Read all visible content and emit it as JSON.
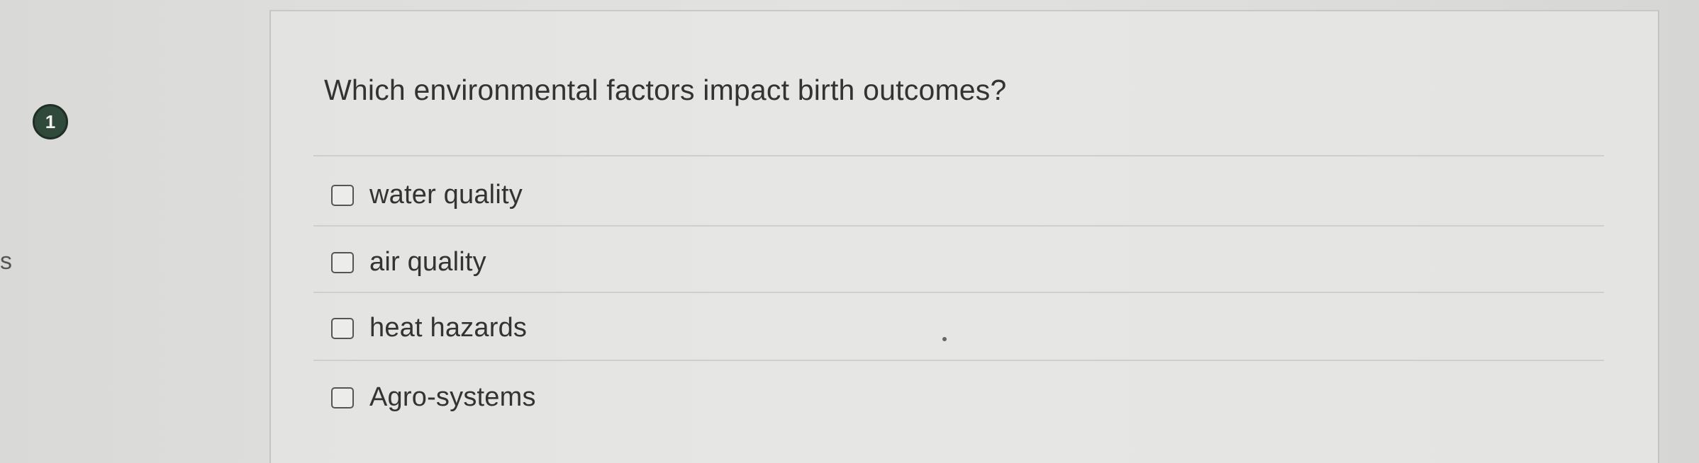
{
  "question_number": "1",
  "side_letter": "s",
  "question": {
    "text": "Which environmental factors impact birth outcomes?"
  },
  "options": [
    {
      "label": "water quality",
      "checked": false
    },
    {
      "label": "air quality",
      "checked": false
    },
    {
      "label": "heat hazards",
      "checked": false
    },
    {
      "label": "Agro-systems",
      "checked": false
    }
  ],
  "colors": {
    "badge_background": "#2f4a3a",
    "text": "#333333",
    "divider": "#cfcfcd"
  }
}
